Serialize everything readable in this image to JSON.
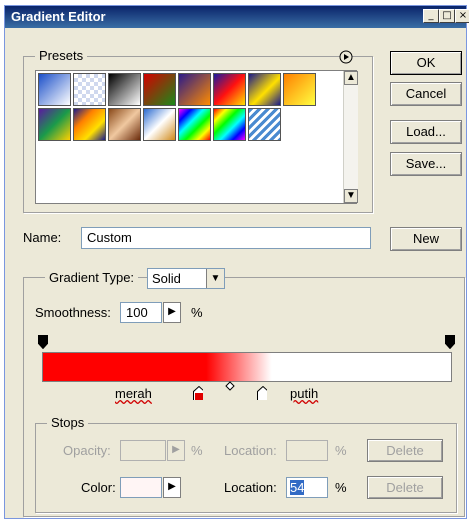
{
  "window": {
    "title": "Gradient Editor",
    "controls": [
      "_",
      "□",
      "×"
    ]
  },
  "presets": {
    "label": "Presets",
    "menu_icon": "circle-arrow-icon"
  },
  "buttons": {
    "ok": "OK",
    "cancel": "Cancel",
    "load": "Load...",
    "save": "Save...",
    "new": "New"
  },
  "name": {
    "label": "Name:",
    "value": "Custom"
  },
  "gradient": {
    "type_label": "Gradient Type:",
    "type_value": "Solid",
    "smoothness_label": "Smoothness:",
    "smoothness_value": "100",
    "percent": "%",
    "color_start": "#ff0000",
    "color_end": "#ffffff",
    "annotation_left": "merah",
    "annotation_right": "putih"
  },
  "stops": {
    "label": "Stops",
    "opacity_label": "Opacity:",
    "opacity_unit": "%",
    "location_label": "Location:",
    "location_unit": "%",
    "delete_label": "Delete",
    "color_label": "Color:",
    "color_location_label": "Location:",
    "color_location_value": "54",
    "color_location_unit": "%",
    "color_delete_label": "Delete"
  }
}
